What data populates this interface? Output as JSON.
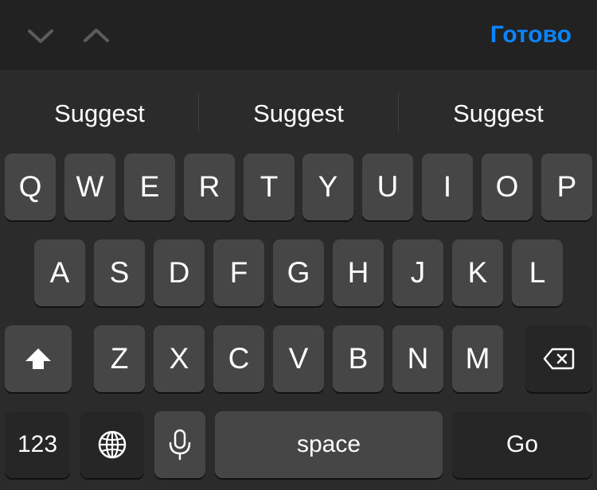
{
  "toolbar": {
    "prev_icon": "chevron-down-icon",
    "next_icon": "chevron-up-icon",
    "done_label": "Готово",
    "done_color": "#0a84ff"
  },
  "suggestions": [
    "Suggest",
    "Suggest",
    "Suggest"
  ],
  "keyboard": {
    "row1": [
      "Q",
      "W",
      "E",
      "R",
      "T",
      "Y",
      "U",
      "I",
      "O",
      "P"
    ],
    "row2": [
      "A",
      "S",
      "D",
      "F",
      "G",
      "H",
      "J",
      "K",
      "L"
    ],
    "row3": [
      "Z",
      "X",
      "C",
      "V",
      "B",
      "N",
      "M"
    ],
    "shift_icon": "shift-icon",
    "backspace_icon": "backspace-icon",
    "numbers_label": "123",
    "globe_icon": "globe-icon",
    "mic_icon": "microphone-icon",
    "space_label": "space",
    "go_label": "Go",
    "key_color": "#464646",
    "function_key_color": "#262626"
  }
}
